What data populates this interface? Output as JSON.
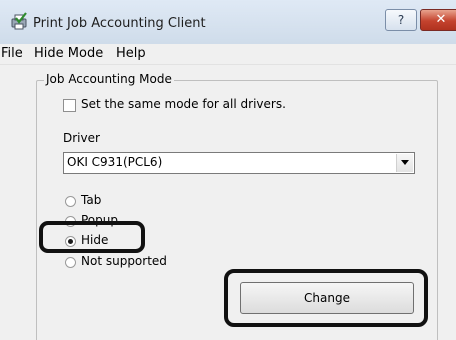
{
  "window": {
    "title": "Print Job Accounting Client",
    "help_button": "?",
    "close_button": "✕"
  },
  "menubar": {
    "items": [
      "File",
      "Hide Mode",
      "Help"
    ]
  },
  "group": {
    "label": "Job Accounting Mode",
    "same_mode_checkbox": {
      "label": "Set the same mode for all drivers.",
      "checked": false
    },
    "driver_label": "Driver",
    "driver_dropdown": {
      "value": "OKI C931(PCL6)"
    },
    "radios": [
      {
        "label": "Tab",
        "checked": false
      },
      {
        "label": "Popup",
        "checked": false
      },
      {
        "label": "Hide",
        "checked": true
      },
      {
        "label": "Not supported",
        "checked": false
      }
    ],
    "change_button": "Change"
  }
}
